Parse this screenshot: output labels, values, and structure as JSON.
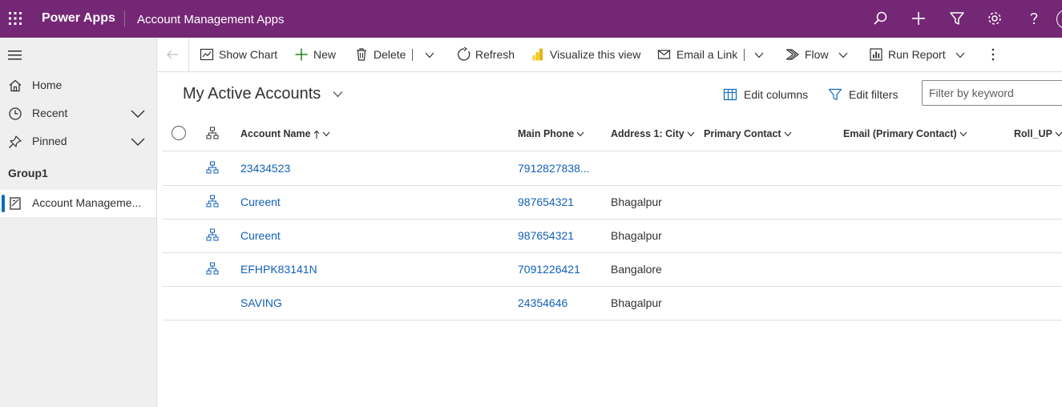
{
  "topbar": {
    "brand": "Power Apps",
    "app_title": "Account Management Apps"
  },
  "sidebar": {
    "items": [
      {
        "label": "Home"
      },
      {
        "label": "Recent"
      },
      {
        "label": "Pinned"
      }
    ],
    "group_title": "Group1",
    "active_item": "Account Manageme..."
  },
  "commands": {
    "show_chart": "Show Chart",
    "new": "New",
    "delete": "Delete",
    "refresh": "Refresh",
    "visualize": "Visualize this view",
    "email_link": "Email a Link",
    "flow": "Flow",
    "run_report": "Run Report"
  },
  "view": {
    "title": "My Active Accounts",
    "edit_columns": "Edit columns",
    "edit_filters": "Edit filters",
    "filter_placeholder": "Filter by keyword"
  },
  "grid": {
    "columns": {
      "account_name": "Account Name",
      "main_phone": "Main Phone",
      "city": "Address 1: City",
      "primary_contact": "Primary Contact",
      "email": "Email (Primary Contact)",
      "roll_up": "Roll_UP"
    },
    "rows": [
      {
        "name": "23434523",
        "phone": "7912827838...",
        "city": ""
      },
      {
        "name": "Cureent",
        "phone": "987654321",
        "city": "Bhagalpur"
      },
      {
        "name": "Cureent",
        "phone": "987654321",
        "city": "Bhagalpur"
      },
      {
        "name": "EFHPK83141N",
        "phone": "7091226421",
        "city": "Bangalore"
      },
      {
        "name": "SAVING",
        "phone": "24354646",
        "city": "Bhagalpur"
      }
    ]
  },
  "colors": {
    "topbar": "#742774",
    "link": "#1160b7",
    "accent": "#0f6cbd"
  }
}
